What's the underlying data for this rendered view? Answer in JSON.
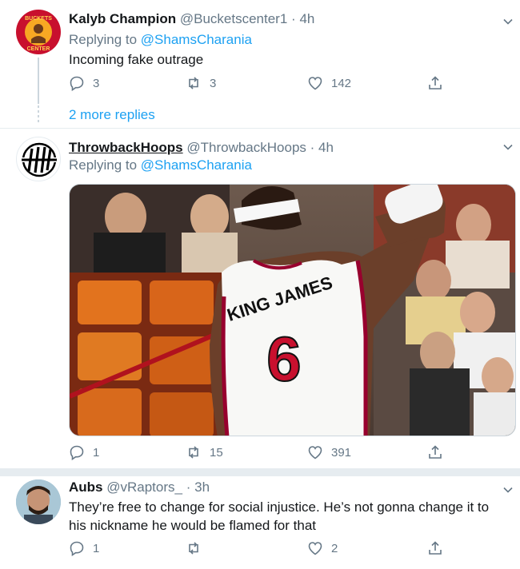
{
  "tweets": [
    {
      "name": "Kalyb Champion",
      "handle": "@Bucketscenter1",
      "sep": "·",
      "time": "4h",
      "reply_prefix": "Replying to ",
      "reply_mention": "@ShamsCharania",
      "text": "Incoming fake outrage",
      "replies": "3",
      "retweets": "3",
      "likes": "142",
      "avatar_text": "BUCKETS CENTER"
    },
    {
      "name": "ThrowbackHoops",
      "handle": "@ThrowbackHoops",
      "sep": "·",
      "time": "4h",
      "reply_prefix": "Replying to ",
      "reply_mention": "@ShamsCharania",
      "jersey_text": "KING JAMES",
      "jersey_number": "6",
      "replies": "1",
      "retweets": "15",
      "likes": "391"
    },
    {
      "name": "Aubs",
      "handle": "@vRaptors_",
      "sep": "·",
      "time": "3h",
      "text_line1": "They’re free to change for social injustice. He’s not gonna change it to",
      "text_line2": "his nickname he would be flamed for that",
      "replies": "1",
      "retweets": "",
      "likes": "2"
    }
  ],
  "more_replies": "2 more replies",
  "colors": {
    "accent": "#1da1f2",
    "muted": "#657786",
    "avatar_red": "#c8102e",
    "heat_red": "#98002e"
  }
}
